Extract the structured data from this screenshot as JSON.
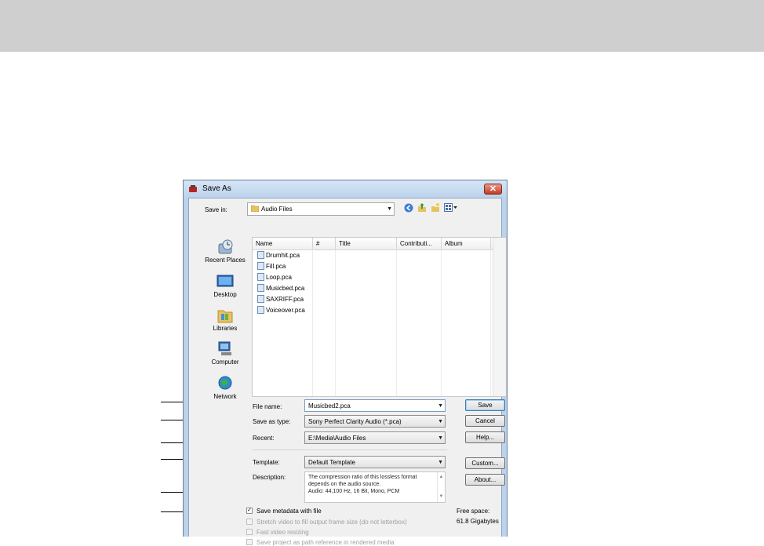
{
  "dialog": {
    "title": "Save As",
    "close_glyph": "✕",
    "save_in_label": "Save in:",
    "save_in_value": "Audio Files",
    "toolbar_icons": [
      "back-icon",
      "up-folder-icon",
      "new-folder-icon",
      "views-menu-icon"
    ]
  },
  "places": [
    {
      "label": "Recent Places",
      "icon": "recent-places-icon"
    },
    {
      "label": "Desktop",
      "icon": "desktop-icon"
    },
    {
      "label": "Libraries",
      "icon": "libraries-icon"
    },
    {
      "label": "Computer",
      "icon": "computer-icon"
    },
    {
      "label": "Network",
      "icon": "network-icon"
    }
  ],
  "list": {
    "sort_glyph": "^",
    "columns": [
      "Name",
      "#",
      "Title",
      "Contributi...",
      "Album"
    ],
    "files": [
      "Drumhit.pca",
      "Fill.pca",
      "Loop.pca",
      "Musicbed.pca",
      "SAXRIFF.pca",
      "Voiceover.pca"
    ]
  },
  "form": {
    "file_name_label": "File name:",
    "file_name_value": "Musicbed2.pca",
    "save_as_type_label": "Save as type:",
    "save_as_type_value": "Sony Perfect Clarity Audio (*.pca)",
    "recent_label": "Recent:",
    "recent_value": "E:\\Media\\Audio Files",
    "template_label": "Template:",
    "template_value": "Default Template",
    "description_label": "Description:",
    "description_text": [
      "The compression ratio of this lossless format",
      "depends on the audio source.",
      "Audio: 44,100 Hz, 16 Bit, Mono, PCM"
    ],
    "description_scroll_up": "▲",
    "description_scroll_down": "▼"
  },
  "buttons": {
    "save": "Save",
    "cancel": "Cancel",
    "help": "Help...",
    "custom": "Custom...",
    "about": "About..."
  },
  "options": {
    "checked_glyph": "✓",
    "save_metadata": {
      "label": "Save metadata with file",
      "checked": true,
      "enabled": true
    },
    "stretch_video": {
      "label": "Stretch video to fill output frame size (do not letterbox)",
      "checked": false,
      "enabled": false
    },
    "fast_resizing": {
      "label": "Fast video resizing",
      "checked": false,
      "enabled": false
    },
    "save_path_ref": {
      "label": "Save project as path reference in rendered media",
      "checked": false,
      "enabled": false
    }
  },
  "free_space": {
    "label": "Free space:",
    "value": "61.8 Gigabytes"
  },
  "colors": {
    "window_frame": "#bcd3ec",
    "top_band": "#cfcfcf",
    "close_button": "#c73a24"
  }
}
